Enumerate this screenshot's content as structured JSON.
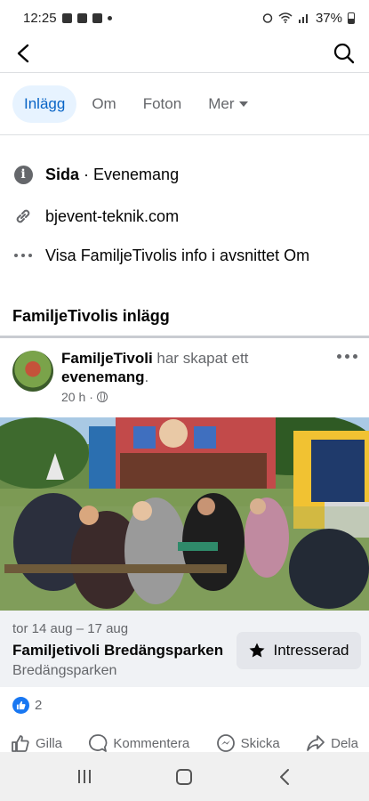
{
  "status_bar": {
    "time": "12:25",
    "battery": "37%"
  },
  "tabs": [
    {
      "label": "Inlägg",
      "active": true
    },
    {
      "label": "Om"
    },
    {
      "label": "Foton"
    },
    {
      "label": "Mer"
    }
  ],
  "info": {
    "category_strong": "Sida",
    "category_rest": " · Evenemang",
    "website": "bjevent-teknik.com",
    "more_info": "Visa FamiljeTivolis info i avsnittet Om"
  },
  "section_title": "FamiljeTivolis inlägg",
  "post": {
    "author": "FamiljeTivoli",
    "action": " har skapat ett ",
    "object": "evenemang",
    "period": ".",
    "time": "20 h",
    "separator": " · "
  },
  "event": {
    "date": "tor 14 aug – 17 aug",
    "title": "Familjetivoli Bredängsparken",
    "place": "Bredängsparken",
    "button_label": "Intresserad"
  },
  "reactions": {
    "count": "2"
  },
  "actions": {
    "like": "Gilla",
    "comment": "Kommentera",
    "send": "Skicka",
    "share": "Dela"
  },
  "colors": {
    "accent": "#0864c6",
    "like_blue": "#1877f2",
    "muted": "#65676b"
  }
}
